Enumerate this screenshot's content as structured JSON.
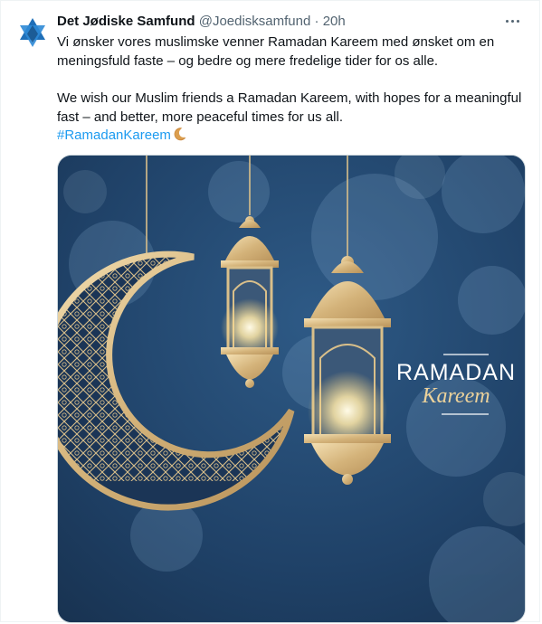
{
  "tweet": {
    "display_name": "Det Jødiske Samfund",
    "handle": "@Joedisksamfund",
    "separator": "·",
    "time": "20h",
    "text_da": "Vi ønsker vores muslimske venner Ramadan Kareem med ønsket om en meningsfuld faste – og bedre og mere fredelige tider for os alle.",
    "text_en": "We wish our Muslim friends a Ramadan Kareem, with hopes for a meaningful fast – and better, more peaceful times for us all.",
    "hashtag": "#RamadanKareem",
    "emoji": "crescent-moon-icon"
  },
  "avatar": {
    "icon": "star-of-david-icon",
    "color": "#1f6fb8"
  },
  "media": {
    "title_line1": "RAMADAN",
    "title_line2": "Kareem",
    "background_color": "#1d3b5e",
    "accent_gold": "#d9bf8a"
  },
  "colors": {
    "link": "#1d9bf0",
    "secondary": "#536471",
    "primary_text": "#0f1419"
  }
}
